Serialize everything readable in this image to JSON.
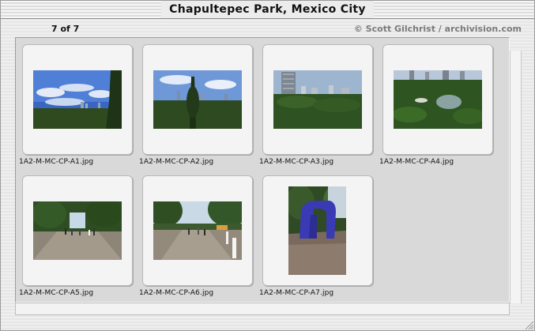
{
  "window": {
    "title": "Chapultepec Park, Mexico City"
  },
  "header": {
    "count": "7 of 7",
    "credit": "© Scott Gilchrist / archivision.com"
  },
  "items": [
    {
      "filename": "1A2-M-MC-CP-A1.jpg",
      "orientation": "landscape",
      "scene": "skyline with clouds over park"
    },
    {
      "filename": "1A2-M-MC-CP-A2.jpg",
      "orientation": "landscape",
      "scene": "distant towers over trees"
    },
    {
      "filename": "1A2-M-MC-CP-A3.jpg",
      "orientation": "landscape",
      "scene": "tower and city beyond forest"
    },
    {
      "filename": "1A2-M-MC-CP-A4.jpg",
      "orientation": "landscape",
      "scene": "lake among trees with city"
    },
    {
      "filename": "1A2-M-MC-CP-A5.jpg",
      "orientation": "landscape",
      "scene": "paved promenade with people"
    },
    {
      "filename": "1A2-M-MC-CP-A6.jpg",
      "orientation": "landscape",
      "scene": "busy park walkway"
    },
    {
      "filename": "1A2-M-MC-CP-A7.jpg",
      "orientation": "portrait",
      "scene": "blue sculpture in garden"
    }
  ],
  "colors": {
    "content_bg": "#d9d9d9",
    "slide_bg": "#f4f4f4",
    "sculpture": "#3a3ab4"
  }
}
